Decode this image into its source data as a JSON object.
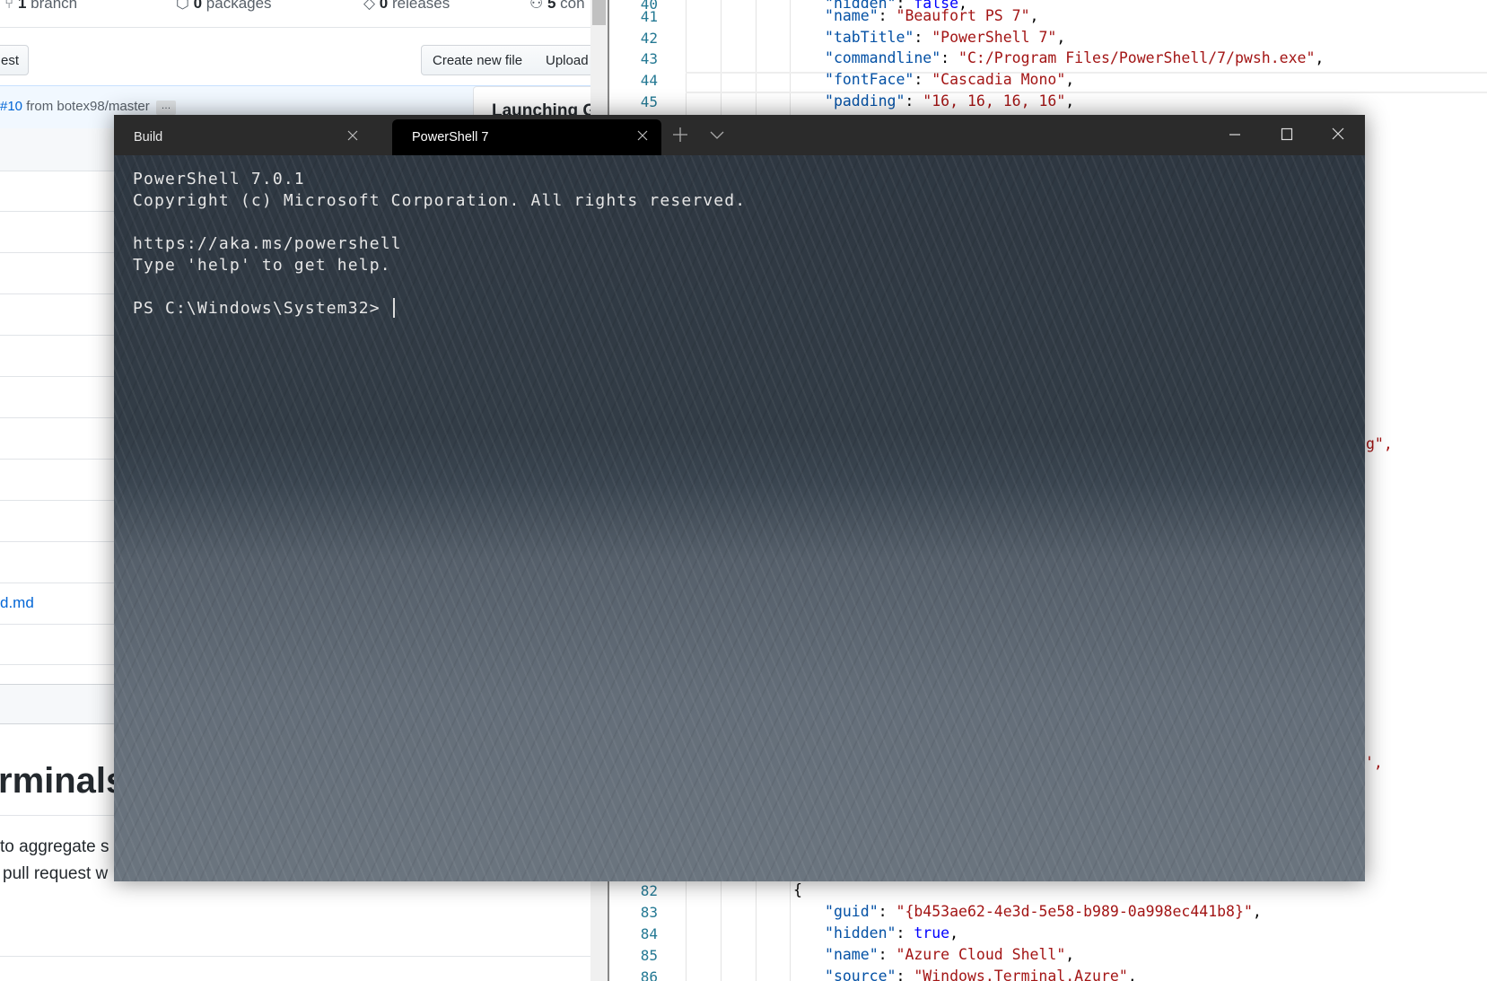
{
  "github": {
    "stats": [
      {
        "icon": "branch-icon",
        "count": "1",
        "label": "branch"
      },
      {
        "icon": "package-icon",
        "count": "0",
        "label": "packages"
      },
      {
        "icon": "tag-icon",
        "count": "0",
        "label": "releases"
      },
      {
        "icon": "people-icon",
        "count": "5",
        "label": "con"
      }
    ],
    "pull_request_button": "est",
    "create_file_button": "Create new file",
    "upload_button": "Upload",
    "commit_pr": "#10",
    "commit_text": " from botex98/master",
    "commit_more": "…",
    "card_title": "Launching G",
    "file_link": "d.md",
    "readme_heading": "rminals",
    "readme_lines": [
      "to aggregate s",
      "pull request w"
    ]
  },
  "editor": {
    "lines": [
      {
        "num": "40",
        "indent": 2,
        "key": "hidden",
        "value": "false",
        "type": "bool"
      },
      {
        "num": "41",
        "indent": 2,
        "key": "name",
        "value": "Beaufort PS 7",
        "type": "string"
      },
      {
        "num": "42",
        "indent": 2,
        "key": "tabTitle",
        "value": "PowerShell 7",
        "type": "string"
      },
      {
        "num": "43",
        "indent": 2,
        "key": "commandline",
        "value": "C:/Program Files/PowerShell/7/pwsh.exe",
        "type": "string"
      },
      {
        "num": "44",
        "indent": 2,
        "key": "fontFace",
        "value": "Cascadia Mono",
        "type": "string"
      },
      {
        "num": "45",
        "indent": 2,
        "key": "padding",
        "value": "16, 16, 16, 16",
        "type": "string"
      },
      {
        "num": "82",
        "indent": 1,
        "raw": "{"
      },
      {
        "num": "83",
        "indent": 2,
        "key": "guid",
        "value": "{b453ae62-4e3d-5e58-b989-0a998ec441b8}",
        "type": "string"
      },
      {
        "num": "84",
        "indent": 2,
        "key": "hidden",
        "value": "true",
        "type": "bool"
      },
      {
        "num": "85",
        "indent": 2,
        "key": "name",
        "value": "Azure Cloud Shell",
        "type": "string"
      },
      {
        "num": "86",
        "indent": 2,
        "key": "source",
        "value": "Windows.Terminal.Azure",
        "type": "string"
      }
    ],
    "fragments": [
      "g\",",
      "',"
    ]
  },
  "terminal": {
    "tabs": [
      {
        "label": "Build",
        "active": false
      },
      {
        "label": "PowerShell 7",
        "active": true
      }
    ],
    "new_tab_icon": "plus-icon",
    "dropdown_icon": "chevron-down-icon",
    "output": "PowerShell 7.0.1\nCopyright (c) Microsoft Corporation. All rights reserved.\n\nhttps://aka.ms/powershell\nType 'help' to get help.\n\nPS C:\\Windows\\System32> ",
    "colors": {
      "tabbar": "#2b2b2b",
      "active_tab": "#000000",
      "text": "#e6e6e6"
    }
  }
}
